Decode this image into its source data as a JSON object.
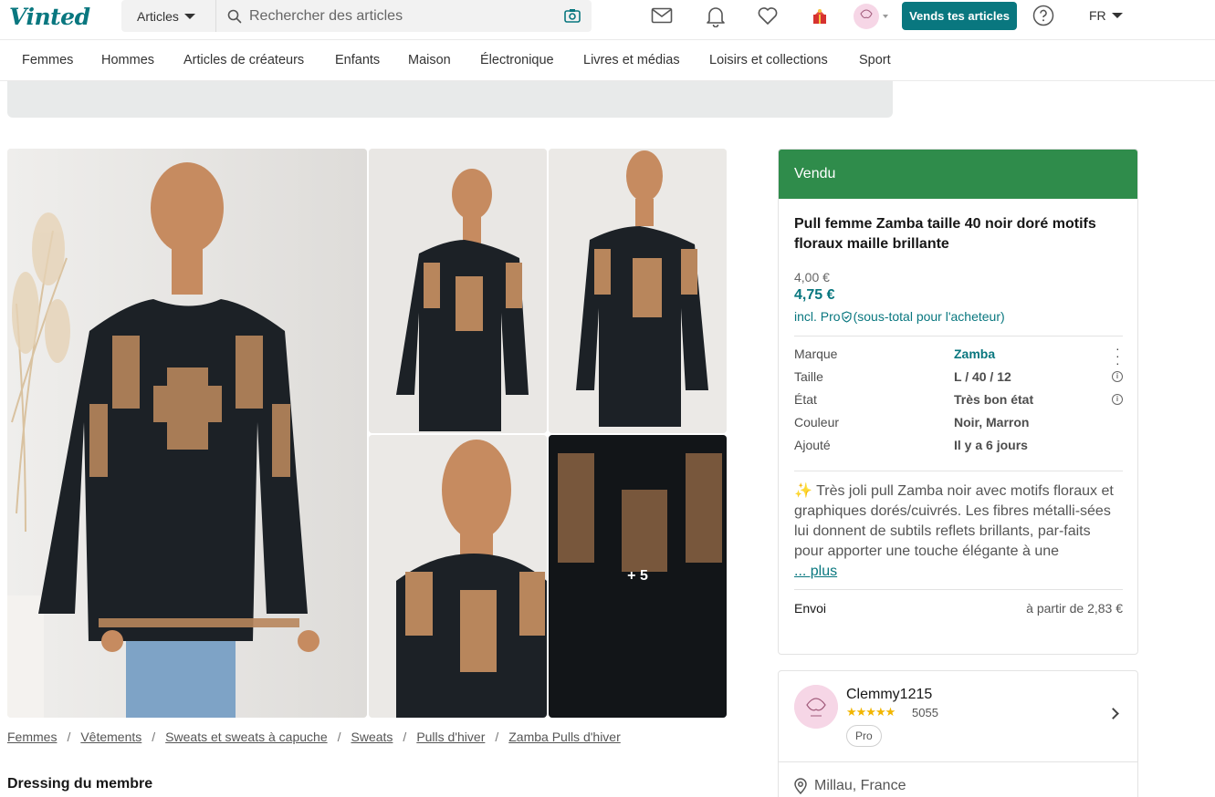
{
  "header": {
    "logo": "Vinted",
    "search_category": "Articles",
    "search_placeholder": "Rechercher des articles",
    "sell_button": "Vends tes articles",
    "language": "FR"
  },
  "categories": [
    "Femmes",
    "Hommes",
    "Articles de créateurs",
    "Enfants",
    "Maison",
    "Électronique",
    "Livres et médias",
    "Loisirs et collections",
    "Sport"
  ],
  "gallery": {
    "more_count": "+ 5"
  },
  "breadcrumb": [
    "Femmes",
    "Vêtements",
    "Sweats et sweats à capuche",
    "Sweats",
    "Pulls d'hiver",
    "Zamba Pulls d'hiver"
  ],
  "breadcrumb_sep": "/",
  "dressing_title": "Dressing du membre",
  "item": {
    "status": "Vendu",
    "title": "Pull femme Zamba taille 40 noir doré motifs floraux maille brillante",
    "price": "4,00 €",
    "price_with_protection": "4,75 €",
    "incl_label": "incl. Pro",
    "incl_suffix": "(sous-total pour l'acheteur)",
    "details": [
      {
        "label": "Marque",
        "value": "Zamba"
      },
      {
        "label": "Taille",
        "value": "L / 40 / 12"
      },
      {
        "label": "État",
        "value": "Très bon état"
      },
      {
        "label": "Couleur",
        "value": "Noir, Marron"
      },
      {
        "label": "Ajouté",
        "value": "Il y a 6 jours"
      }
    ],
    "description": "✨ Très joli pull Zamba noir avec motifs floraux et graphiques dorés/cuivrés. Les fibres métalli-sées lui donnent de subtils reflets brillants, par-faits pour apporter une touche élégante à une",
    "more_link": "... plus",
    "shipping_label": "Envoi",
    "shipping_value": "à partir de 2,83 €"
  },
  "seller": {
    "name": "Clemmy1215",
    "stars": "★★★★★",
    "rating_count": "5055",
    "badge": "Pro",
    "location": "Millau, France"
  },
  "colors": {
    "brand": "#09777f",
    "sold_banner": "#2f8c4b"
  }
}
